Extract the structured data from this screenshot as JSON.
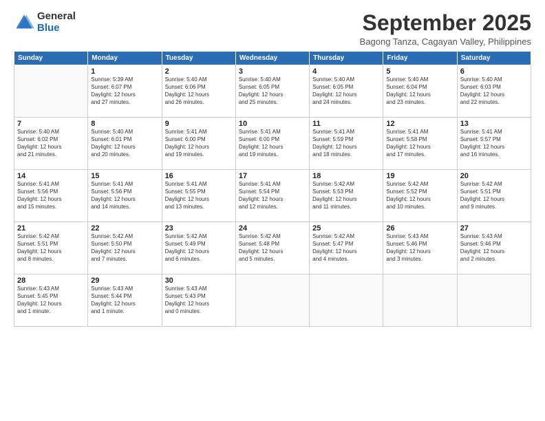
{
  "logo": {
    "general": "General",
    "blue": "Blue"
  },
  "title": "September 2025",
  "location": "Bagong Tanza, Cagayan Valley, Philippines",
  "days_of_week": [
    "Sunday",
    "Monday",
    "Tuesday",
    "Wednesday",
    "Thursday",
    "Friday",
    "Saturday"
  ],
  "weeks": [
    [
      {
        "day": "",
        "info": ""
      },
      {
        "day": "1",
        "info": "Sunrise: 5:39 AM\nSunset: 6:07 PM\nDaylight: 12 hours\nand 27 minutes."
      },
      {
        "day": "2",
        "info": "Sunrise: 5:40 AM\nSunset: 6:06 PM\nDaylight: 12 hours\nand 26 minutes."
      },
      {
        "day": "3",
        "info": "Sunrise: 5:40 AM\nSunset: 6:05 PM\nDaylight: 12 hours\nand 25 minutes."
      },
      {
        "day": "4",
        "info": "Sunrise: 5:40 AM\nSunset: 6:05 PM\nDaylight: 12 hours\nand 24 minutes."
      },
      {
        "day": "5",
        "info": "Sunrise: 5:40 AM\nSunset: 6:04 PM\nDaylight: 12 hours\nand 23 minutes."
      },
      {
        "day": "6",
        "info": "Sunrise: 5:40 AM\nSunset: 6:03 PM\nDaylight: 12 hours\nand 22 minutes."
      }
    ],
    [
      {
        "day": "7",
        "info": "Sunrise: 5:40 AM\nSunset: 6:02 PM\nDaylight: 12 hours\nand 21 minutes."
      },
      {
        "day": "8",
        "info": "Sunrise: 5:40 AM\nSunset: 6:01 PM\nDaylight: 12 hours\nand 20 minutes."
      },
      {
        "day": "9",
        "info": "Sunrise: 5:41 AM\nSunset: 6:00 PM\nDaylight: 12 hours\nand 19 minutes."
      },
      {
        "day": "10",
        "info": "Sunrise: 5:41 AM\nSunset: 6:00 PM\nDaylight: 12 hours\nand 19 minutes."
      },
      {
        "day": "11",
        "info": "Sunrise: 5:41 AM\nSunset: 5:59 PM\nDaylight: 12 hours\nand 18 minutes."
      },
      {
        "day": "12",
        "info": "Sunrise: 5:41 AM\nSunset: 5:58 PM\nDaylight: 12 hours\nand 17 minutes."
      },
      {
        "day": "13",
        "info": "Sunrise: 5:41 AM\nSunset: 5:57 PM\nDaylight: 12 hours\nand 16 minutes."
      }
    ],
    [
      {
        "day": "14",
        "info": "Sunrise: 5:41 AM\nSunset: 5:56 PM\nDaylight: 12 hours\nand 15 minutes."
      },
      {
        "day": "15",
        "info": "Sunrise: 5:41 AM\nSunset: 5:56 PM\nDaylight: 12 hours\nand 14 minutes."
      },
      {
        "day": "16",
        "info": "Sunrise: 5:41 AM\nSunset: 5:55 PM\nDaylight: 12 hours\nand 13 minutes."
      },
      {
        "day": "17",
        "info": "Sunrise: 5:41 AM\nSunset: 5:54 PM\nDaylight: 12 hours\nand 12 minutes."
      },
      {
        "day": "18",
        "info": "Sunrise: 5:42 AM\nSunset: 5:53 PM\nDaylight: 12 hours\nand 11 minutes."
      },
      {
        "day": "19",
        "info": "Sunrise: 5:42 AM\nSunset: 5:52 PM\nDaylight: 12 hours\nand 10 minutes."
      },
      {
        "day": "20",
        "info": "Sunrise: 5:42 AM\nSunset: 5:51 PM\nDaylight: 12 hours\nand 9 minutes."
      }
    ],
    [
      {
        "day": "21",
        "info": "Sunrise: 5:42 AM\nSunset: 5:51 PM\nDaylight: 12 hours\nand 8 minutes."
      },
      {
        "day": "22",
        "info": "Sunrise: 5:42 AM\nSunset: 5:50 PM\nDaylight: 12 hours\nand 7 minutes."
      },
      {
        "day": "23",
        "info": "Sunrise: 5:42 AM\nSunset: 5:49 PM\nDaylight: 12 hours\nand 6 minutes."
      },
      {
        "day": "24",
        "info": "Sunrise: 5:42 AM\nSunset: 5:48 PM\nDaylight: 12 hours\nand 5 minutes."
      },
      {
        "day": "25",
        "info": "Sunrise: 5:42 AM\nSunset: 5:47 PM\nDaylight: 12 hours\nand 4 minutes."
      },
      {
        "day": "26",
        "info": "Sunrise: 5:43 AM\nSunset: 5:46 PM\nDaylight: 12 hours\nand 3 minutes."
      },
      {
        "day": "27",
        "info": "Sunrise: 5:43 AM\nSunset: 5:46 PM\nDaylight: 12 hours\nand 2 minutes."
      }
    ],
    [
      {
        "day": "28",
        "info": "Sunrise: 5:43 AM\nSunset: 5:45 PM\nDaylight: 12 hours\nand 1 minute."
      },
      {
        "day": "29",
        "info": "Sunrise: 5:43 AM\nSunset: 5:44 PM\nDaylight: 12 hours\nand 1 minute."
      },
      {
        "day": "30",
        "info": "Sunrise: 5:43 AM\nSunset: 5:43 PM\nDaylight: 12 hours\nand 0 minutes."
      },
      {
        "day": "",
        "info": ""
      },
      {
        "day": "",
        "info": ""
      },
      {
        "day": "",
        "info": ""
      },
      {
        "day": "",
        "info": ""
      }
    ]
  ]
}
